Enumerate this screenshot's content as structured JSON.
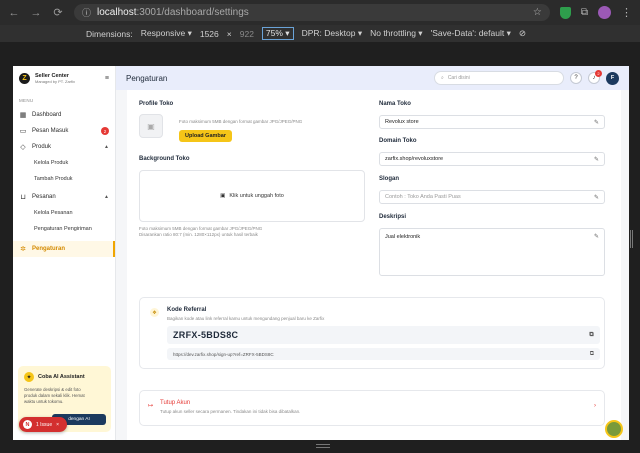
{
  "browser": {
    "url_host": "localhost",
    "url_path": ":3001/dashboard/settings"
  },
  "devtools": {
    "dimensions_label": "Dimensions:",
    "dimensions_value": "Responsive",
    "width": "1526",
    "times": "×",
    "height": "922",
    "zoom": "75%",
    "dpr_label": "DPR:",
    "dpr_value": "Desktop",
    "throttling": "No throttling",
    "save_data": "'Save-Data': default"
  },
  "sidebar": {
    "brand_title": "Seller Center",
    "brand_sub": "Managed by PT. Zarfix",
    "menu_head": "MENU",
    "items": [
      {
        "label": "Dashboard"
      },
      {
        "label": "Pesan Masuk",
        "badge": "2"
      },
      {
        "label": "Produk"
      },
      {
        "label": "Kelola Produk"
      },
      {
        "label": "Tambah Produk"
      },
      {
        "label": "Pesanan"
      },
      {
        "label": "Kelola Pesanan"
      },
      {
        "label": "Pengaturan Pengiriman"
      },
      {
        "label": "Pengaturan"
      }
    ],
    "ai_card": {
      "title": "Coba AI Assistant",
      "text": "Generate deskripsi & edit foto produk dalam sekali klik. Hemat waktu untuk tokomu.",
      "button": "dengan AI"
    },
    "issue": {
      "count": "N",
      "label": "1 Issue",
      "close": "×"
    }
  },
  "topbar": {
    "title": "Pengaturan",
    "search_placeholder": "Cari disini",
    "notif_count": "2",
    "user_initial": "F"
  },
  "form": {
    "profile_label": "Profile Toko",
    "profile_hint": "Foto maksimum 5MB dengan format gambar JPG/JPEG/PNG",
    "upload_button": "Upload Gambar",
    "background_label": "Background Toko",
    "background_drop": "Klik untuk unggah foto",
    "background_hint": "Foto maksimum 5MB dengan format gambar JPG/JPEG/PNG",
    "background_hint2": "Disarankan ratio 80:7 (min. 1280×112px) untuk hasil terbaik",
    "store_name_label": "Nama Toko",
    "store_name_value": "Revolux store",
    "domain_label": "Domain Toko",
    "domain_value": "zarfix.shop/revoluxstore",
    "slogan_label": "Slogan",
    "slogan_placeholder": "Contoh : Toko Anda Pasti Puas",
    "desc_label": "Deskripsi",
    "desc_value": "Jual elektronik"
  },
  "referral": {
    "title": "Kode Referral",
    "subtitle": "Bagikan kode atau link referral kamu untuk mengundang penjual baru ke Zarfix",
    "code": "ZRFX-5BDS8C",
    "link": "https://dev.zarfix.shop/sign-up?ref=ZRFX-5BDS8C"
  },
  "close_account": {
    "title": "Tutup Akun",
    "subtitle": "Tutup akun seller secara permanen. Tindakan ini tidak bisa dibatalkan."
  }
}
